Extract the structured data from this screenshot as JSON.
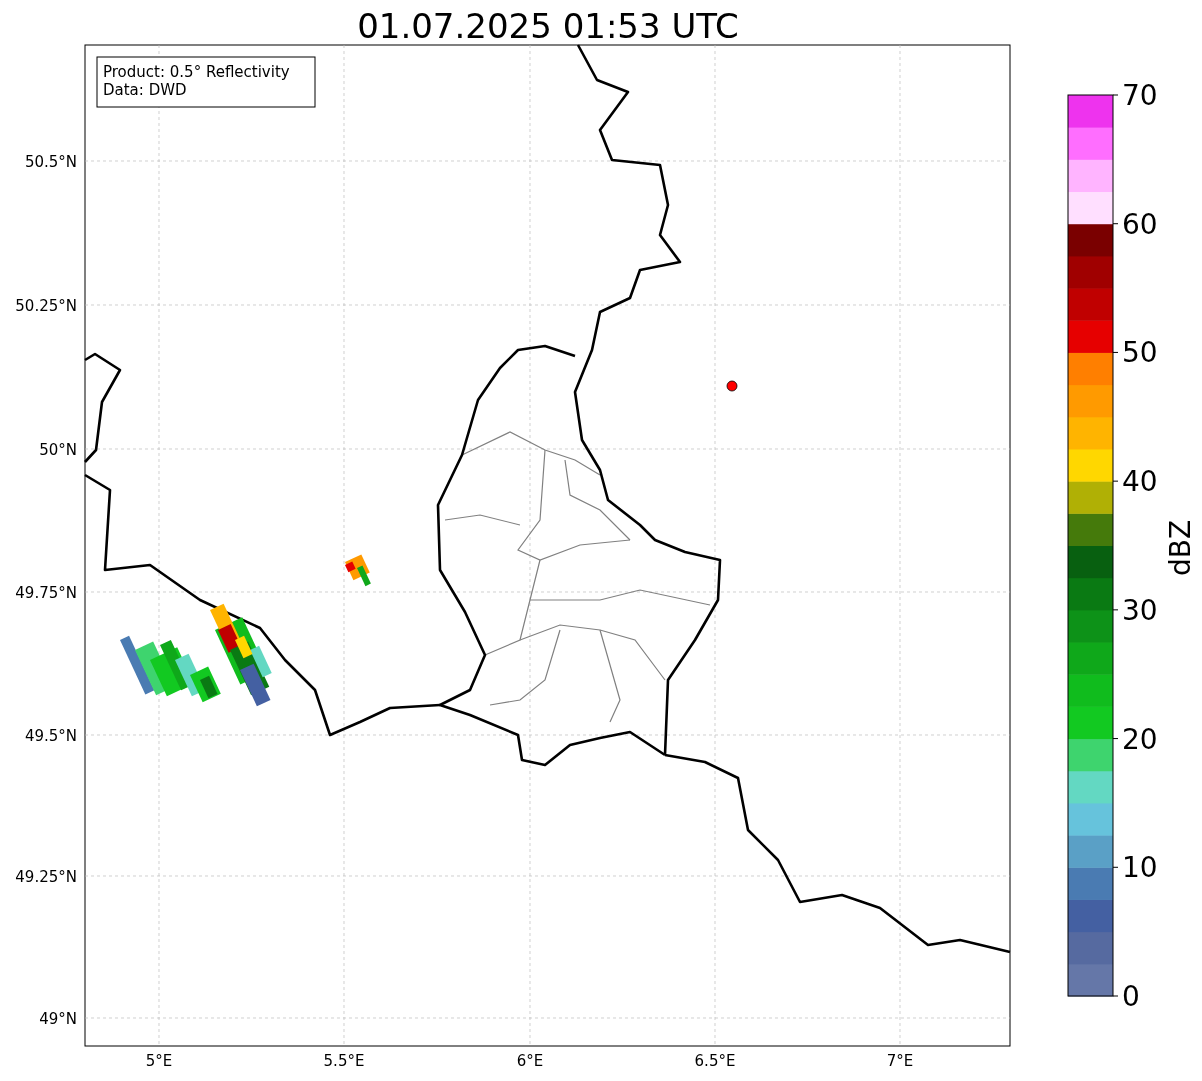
{
  "title": "01.07.2025 01:53 UTC",
  "info_box": [
    "Product: 0.5° Reflectivity",
    "Data: DWD"
  ],
  "map": {
    "lat_labels": [
      "50.5°N",
      "50.25°N",
      "50°N",
      "49.75°N",
      "49.5°N",
      "49.25°N",
      "49°N"
    ],
    "lon_labels": [
      "5°E",
      "5.5°E",
      "6°E",
      "6.5°E",
      "7°E"
    ]
  },
  "colorbar": {
    "label": "dBZ",
    "ticks": [
      "70",
      "60",
      "50",
      "40",
      "30",
      "20",
      "10",
      "0"
    ],
    "segments": [
      {
        "color": "#6577a8"
      },
      {
        "color": "#566aa0"
      },
      {
        "color": "#4460a2"
      },
      {
        "color": "#4a7bb2"
      },
      {
        "color": "#5aa0c6"
      },
      {
        "color": "#66c3dc"
      },
      {
        "color": "#63d8c2"
      },
      {
        "color": "#3ed46e"
      },
      {
        "color": "#12c921"
      },
      {
        "color": "#10bc1d"
      },
      {
        "color": "#0fa81a"
      },
      {
        "color": "#0d9218"
      },
      {
        "color": "#0a7a13"
      },
      {
        "color": "#086010"
      },
      {
        "color": "#457a0b"
      },
      {
        "color": "#b0b005"
      },
      {
        "color": "#ffd700"
      },
      {
        "color": "#ffb400"
      },
      {
        "color": "#ff9a00"
      },
      {
        "color": "#ff7f00"
      },
      {
        "color": "#e60000"
      },
      {
        "color": "#c00000"
      },
      {
        "color": "#a00000"
      },
      {
        "color": "#7a0000"
      },
      {
        "color": "#ffdfff"
      },
      {
        "color": "#ffb4ff"
      },
      {
        "color": "#ff6eff"
      },
      {
        "color": "#ee33ee"
      }
    ]
  }
}
